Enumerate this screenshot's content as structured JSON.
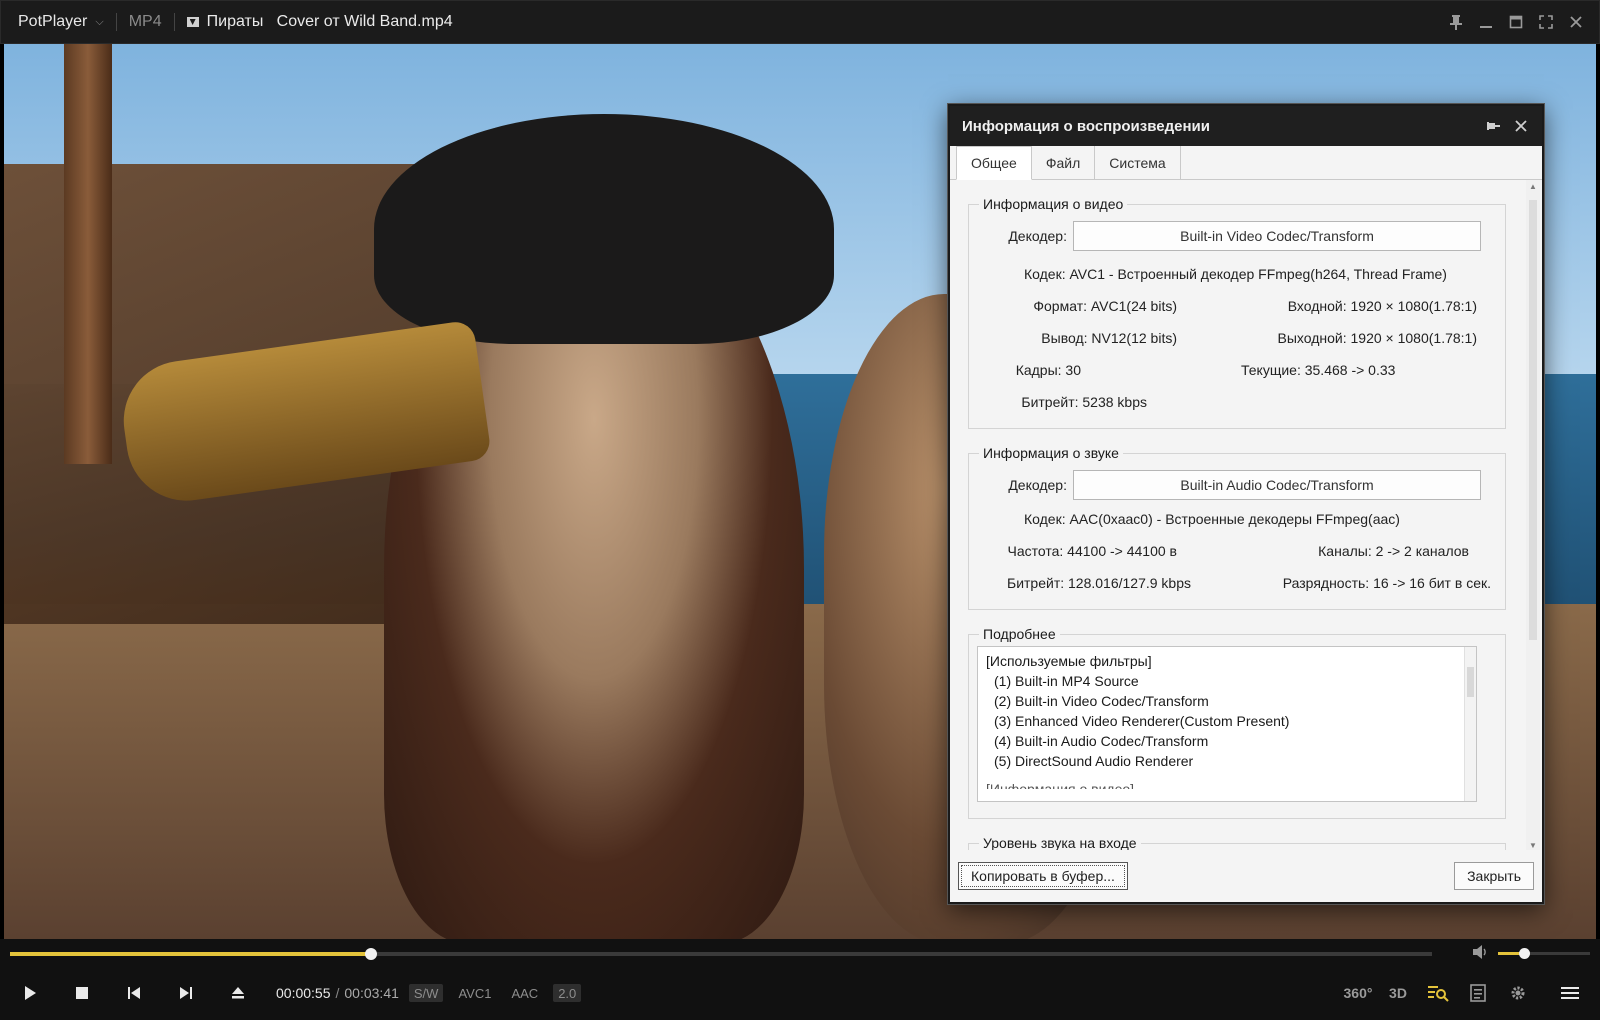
{
  "titlebar": {
    "app_name": "PotPlayer",
    "format": "MP4",
    "file_title": "Пираты   Cover от Wild Band.mp4"
  },
  "dialog": {
    "title": "Информация о воспроизведении",
    "tabs": [
      {
        "label": "Общее",
        "active": true
      },
      {
        "label": "Файл",
        "active": false
      },
      {
        "label": "Система",
        "active": false
      }
    ],
    "video_info": {
      "heading": "Информация о видео",
      "decoder_label": "Декодер:",
      "decoder_value": "Built-in Video Codec/Transform",
      "codec": "Кодек: AVC1 - Встроенный декодер FFmpeg(h264, Thread Frame)",
      "format": "Формат: AVC1(24 bits)",
      "input": "Входной: 1920 × 1080(1.78:1)",
      "output": "Вывод: NV12(12 bits)",
      "output_res": "Выходной: 1920 × 1080(1.78:1)",
      "frames": "Кадры: 30",
      "current": "Текущие: 35.468 -> 0.33",
      "bitrate": "Битрейт: 5238 kbps"
    },
    "audio_info": {
      "heading": "Информация о звуке",
      "decoder_label": "Декодер:",
      "decoder_value": "Built-in Audio Codec/Transform",
      "codec": "Кодек: AAC(0xaac0) - Встроенные декодеры FFmpeg(aac)",
      "frequency": "Частота: 44100 -> 44100 в",
      "channels": "Каналы: 2 -> 2 каналов",
      "bitrate": "Битрейт: 128.016/127.9 kbps",
      "depth": "Разрядность: 16 -> 16 бит в сек."
    },
    "details": {
      "heading": "Подробнее",
      "lines": [
        "[Используемые фильтры]",
        "(1) Built-in MP4 Source",
        "(2) Built-in Video Codec/Transform",
        "(3) Enhanced Video Renderer(Custom Present)",
        "(4) Built-in Audio Codec/Transform",
        "(5) DirectSound Audio Renderer"
      ],
      "cut_line": "[Информация о видео]"
    },
    "input_level": {
      "heading": "Уровень звука на входе"
    },
    "copy_button": "Копировать в буфер...",
    "close_button": "Закрыть"
  },
  "player": {
    "current_time": "00:00:55",
    "time_separator": "/",
    "duration": "00:03:41",
    "progress_fraction": 0.254,
    "volume_fraction": 0.28,
    "badges": [
      "S/W",
      "AVC1",
      "AAC",
      "2.0"
    ],
    "right_buttons": [
      "360°",
      "3D"
    ]
  },
  "colors": {
    "accent": "#e4c33b",
    "titlebar_bg": "#1b1b1b",
    "dialog_bg": "#f4f4f4"
  }
}
